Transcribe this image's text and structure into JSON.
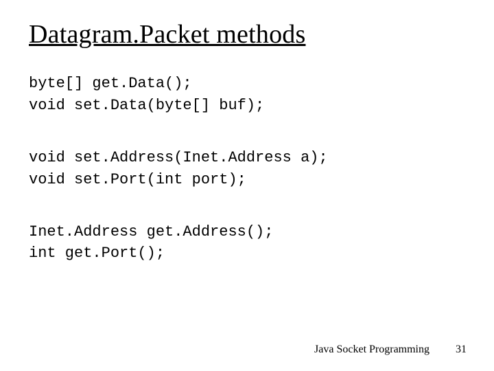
{
  "title": "Datagram.Packet methods",
  "blocks": [
    [
      "byte[] get.Data();",
      "void set.Data(byte[] buf);"
    ],
    [
      "void set.Address(Inet.Address a);",
      "void set.Port(int port);"
    ],
    [
      "Inet.Address get.Address();",
      "int get.Port();"
    ]
  ],
  "footer": {
    "label": "Java Socket Programming",
    "page": "31"
  }
}
